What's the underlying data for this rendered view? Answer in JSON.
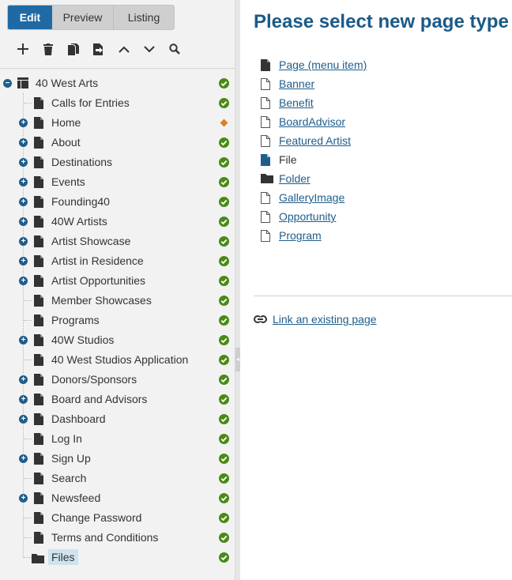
{
  "tabs": {
    "edit": "Edit",
    "preview": "Preview",
    "listing": "Listing"
  },
  "toolbar": {
    "buttons": [
      "plus-icon",
      "trash-icon",
      "copy-icon",
      "move-icon",
      "arrow-up-icon",
      "arrow-down-icon",
      "search-icon"
    ]
  },
  "tree": {
    "root": {
      "label": "40 West Arts",
      "status": "published"
    },
    "items": [
      {
        "label": "Calls for Entries",
        "expandable": false,
        "status": "published"
      },
      {
        "label": "Home",
        "expandable": true,
        "status": "modified"
      },
      {
        "label": "About",
        "expandable": true,
        "status": "published"
      },
      {
        "label": "Destinations",
        "expandable": true,
        "status": "published"
      },
      {
        "label": "Events",
        "expandable": true,
        "status": "published"
      },
      {
        "label": "Founding40",
        "expandable": true,
        "status": "published"
      },
      {
        "label": "40W Artists",
        "expandable": true,
        "status": "published"
      },
      {
        "label": "Artist Showcase",
        "expandable": true,
        "status": "published"
      },
      {
        "label": "Artist in Residence",
        "expandable": true,
        "status": "published"
      },
      {
        "label": "Artist Opportunities",
        "expandable": true,
        "status": "published"
      },
      {
        "label": "Member Showcases",
        "expandable": false,
        "status": "published"
      },
      {
        "label": "Programs",
        "expandable": false,
        "status": "published"
      },
      {
        "label": "40W Studios",
        "expandable": true,
        "status": "published"
      },
      {
        "label": "40 West Studios Application",
        "expandable": false,
        "status": "published"
      },
      {
        "label": "Donors/Sponsors",
        "expandable": true,
        "status": "published"
      },
      {
        "label": "Board and Advisors",
        "expandable": true,
        "status": "published"
      },
      {
        "label": "Dashboard",
        "expandable": true,
        "status": "published"
      },
      {
        "label": "Log In",
        "expandable": false,
        "status": "published"
      },
      {
        "label": "Sign Up",
        "expandable": true,
        "status": "published"
      },
      {
        "label": "Search",
        "expandable": false,
        "status": "published"
      },
      {
        "label": "Newsfeed",
        "expandable": true,
        "status": "published"
      },
      {
        "label": "Change Password",
        "expandable": false,
        "status": "published"
      },
      {
        "label": "Terms and Conditions",
        "expandable": false,
        "status": "published"
      },
      {
        "label": "Files",
        "expandable": false,
        "status": "published",
        "icon": "folder-icon",
        "selected": true
      }
    ]
  },
  "main": {
    "title": "Please select new page type",
    "page_types": [
      {
        "label": "Page (menu item)",
        "icon": "page-filled-icon",
        "link": true
      },
      {
        "label": "Banner",
        "icon": "page-outline-icon",
        "link": true
      },
      {
        "label": "Benefit",
        "icon": "page-outline-icon",
        "link": true
      },
      {
        "label": "BoardAdvisor",
        "icon": "page-outline-icon",
        "link": true
      },
      {
        "label": "Featured Artist",
        "icon": "page-outline-icon",
        "link": true
      },
      {
        "label": "File",
        "icon": "file-blue-icon",
        "link": false
      },
      {
        "label": "Folder",
        "icon": "folder-icon",
        "link": true
      },
      {
        "label": "GalleryImage",
        "icon": "page-outline-icon",
        "link": true
      },
      {
        "label": "Opportunity",
        "icon": "page-outline-icon",
        "link": true
      },
      {
        "label": "Program",
        "icon": "page-outline-icon",
        "link": true
      }
    ],
    "link_existing": "Link an existing page"
  },
  "colors": {
    "accent": "#1f6aa5",
    "title": "#1a5a87",
    "link": "#1f5d8b",
    "status_published": "#4a8a14",
    "status_modified": "#d9822b",
    "selected_bg": "#cfe3ee"
  }
}
